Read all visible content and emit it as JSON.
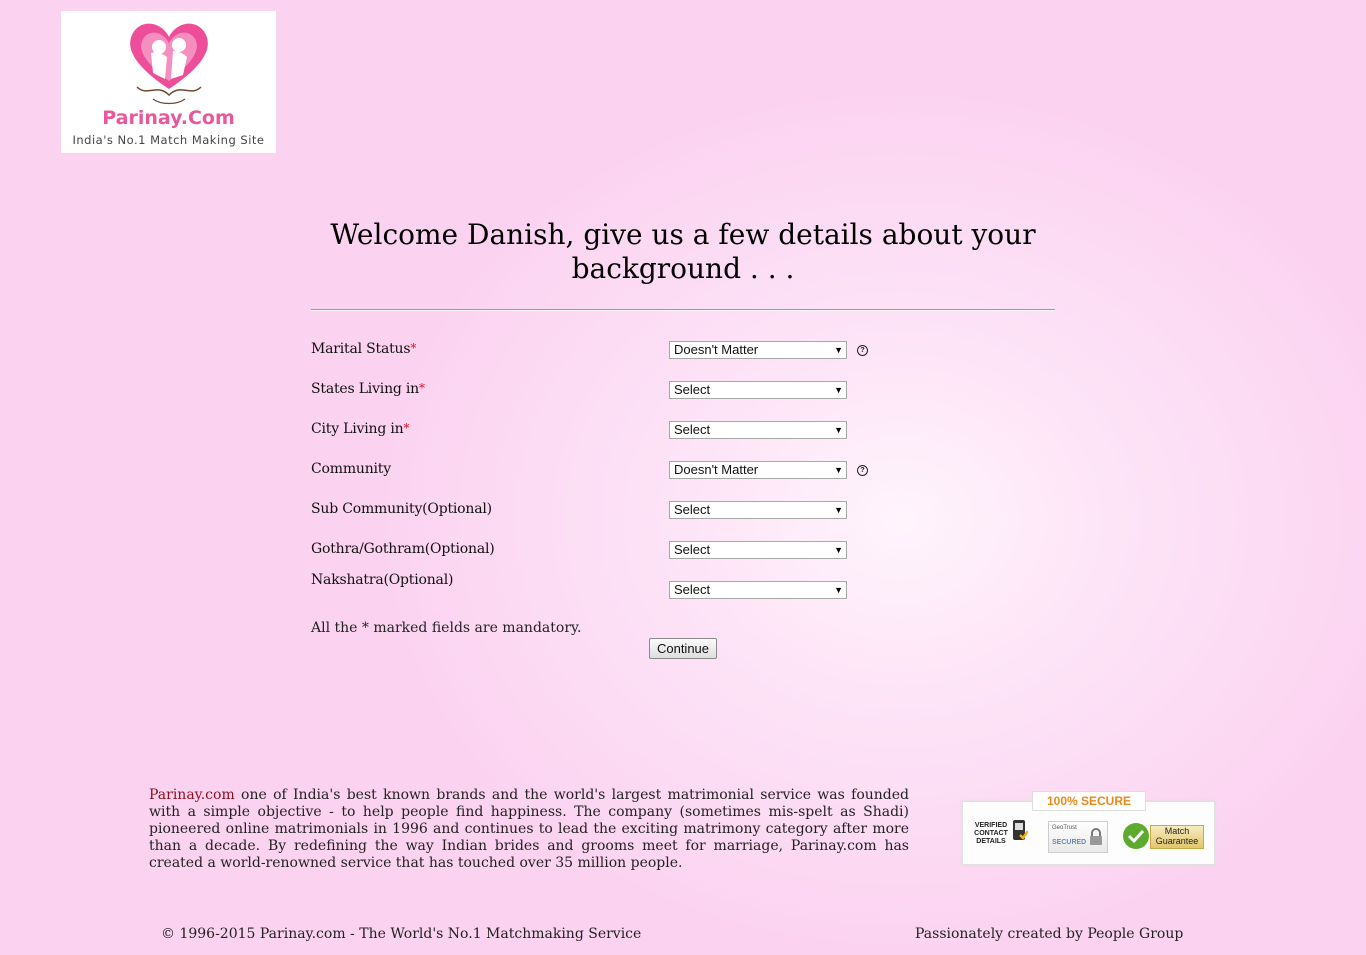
{
  "logo": {
    "name": "Parinay.Com",
    "tagline": "India's No.1 Match Making Site"
  },
  "heading": "Welcome Danish, give us a few details about your background . . .",
  "form": {
    "fields": [
      {
        "label": "Marital Status",
        "required": true,
        "value": "Doesn't Matter",
        "help": true
      },
      {
        "label": "States Living in",
        "required": true,
        "value": "Select",
        "help": false
      },
      {
        "label": "City Living in",
        "required": true,
        "value": "Select",
        "help": false
      },
      {
        "label": "Community",
        "required": false,
        "value": "Doesn't Matter",
        "help": true
      },
      {
        "label": "Sub Community(Optional)",
        "required": false,
        "value": "Select",
        "help": false
      },
      {
        "label": "Gothra/Gothram(Optional)",
        "required": false,
        "value": "Select",
        "help": false
      },
      {
        "label": "Nakshatra(Optional)",
        "required": false,
        "value": "Select",
        "help": false
      }
    ],
    "required_mark": "*",
    "help_symbol": "?",
    "dropdown_arrow": "▼",
    "mandatory_note": "All the * marked fields are mandatory.",
    "continue_label": "Continue"
  },
  "about": {
    "brand": "Parinay.com",
    "text": " one of India's best known brands and the world's largest matrimonial service was founded with a simple objective - to help people find happiness. The company (sometimes mis-spelt as Shadi) pioneered online matrimonials in 1996 and continues to lead the exciting matrimony category after more than a decade. By redefining the way Indian brides and grooms meet for marriage, Parinay.com has created a world-renowned service that has touched over 35 million people."
  },
  "badge": {
    "title": "100% SECURE",
    "verified": "VERIFIED CONTACT DETAILS",
    "geotrust": "GeoTrust",
    "secured": "SECURED",
    "match": "Match Guarantee"
  },
  "footer": {
    "copyright": "© 1996-2015 Parinay.com - The World's No.1 Matchmaking Service",
    "credit": "Passionately created by People Group"
  }
}
